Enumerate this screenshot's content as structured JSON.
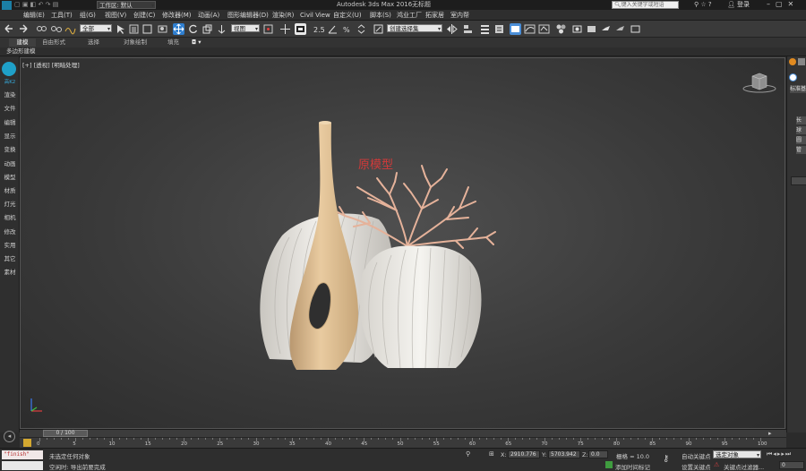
{
  "title_bar": {
    "workspace": "工作区: 默认",
    "app_title": "Autodesk 3ds Max 2016",
    "file_title": "无标题",
    "search_placeholder": "键入关键字或短语",
    "login": "登录"
  },
  "menu": {
    "items": [
      "编辑(E)",
      "工具(T)",
      "组(G)",
      "视图(V)",
      "创建(C)",
      "修改器(M)",
      "动画(A)",
      "图形编辑器(D)",
      "渲染(R)",
      "Civil View",
      "自定义(U)",
      "脚本(S)",
      "鸿业工厂",
      "拓家居",
      "室内帮"
    ]
  },
  "toolbar": {
    "selection_filter": "全部",
    "reference_coord": "视图",
    "named_selection": "创建选择集"
  },
  "ribbon": {
    "tabs": [
      "建模",
      "自由形式",
      "选择",
      "对象绘制",
      "填充"
    ],
    "subtitle": "多边形建模"
  },
  "left_panel": {
    "logo_text": "高K2",
    "items": [
      "渲染",
      "文件",
      "编辑",
      "显示",
      "变换",
      "动画",
      "模型",
      "材质",
      "灯光",
      "相机",
      "修改",
      "实用",
      "其它",
      "素材"
    ]
  },
  "viewport": {
    "label": "[+] [透视] [明暗处理]",
    "annotation": "原模型",
    "annotation_color": "#d23a3a"
  },
  "right_panel": {
    "labels": [
      "标准基",
      "长",
      "球",
      "圆",
      "管"
    ]
  },
  "timeslider": {
    "frame_display": "0 / 100",
    "ticks": [
      "0",
      "5",
      "10",
      "15",
      "20",
      "25",
      "30",
      "35",
      "40",
      "45",
      "50",
      "55",
      "60",
      "65",
      "70",
      "75",
      "80",
      "85",
      "90",
      "95",
      "100"
    ]
  },
  "status": {
    "maxscript": "\"finish\"",
    "selection": "未选定任何对象",
    "prompt": "空闲时: 导出前要完成",
    "x_label": "X:",
    "x_value": "2910.776",
    "y_label": "Y:",
    "y_value": "5703.942",
    "z_label": "Z:",
    "z_value": "0.0",
    "grid": "栅格 = 10.0",
    "add_time_tag": "添加时间标记",
    "auto_key": "自动关键点",
    "selected_object": "选定对象",
    "set_key": "设置关键点",
    "key_filters": "关键点过滤器...",
    "frame": "0"
  },
  "colors": {
    "accent": "#2f7fd0",
    "vase_tan": "#d8bb90",
    "coral": "#e8b49a",
    "shell_white": "#e9e7e2"
  }
}
